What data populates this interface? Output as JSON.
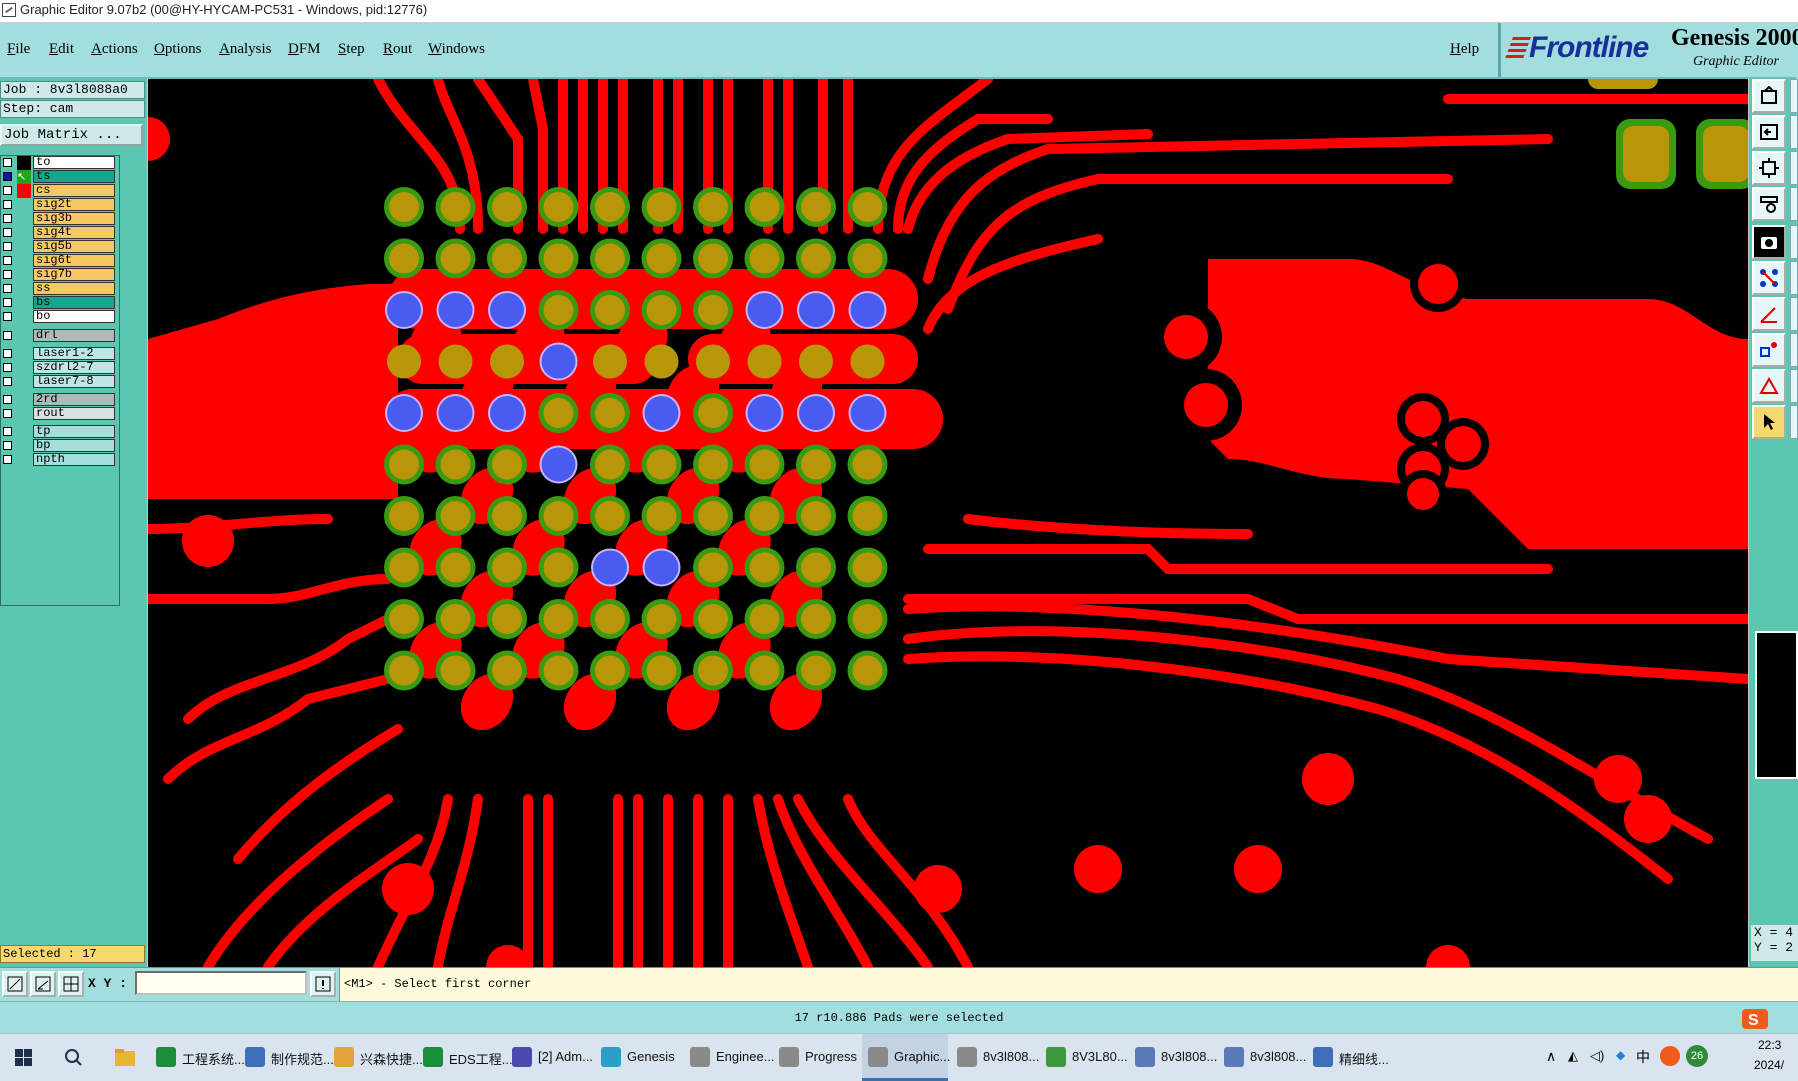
{
  "window": {
    "title": "Graphic Editor 9.07b2 (00@HY-HYCAM-PC531 - Windows, pid:12776)"
  },
  "menu": {
    "items": [
      "File",
      "Edit",
      "Actions",
      "Options",
      "Analysis",
      "DFM",
      "Step",
      "Rout",
      "Windows"
    ],
    "help": "Help"
  },
  "brand": {
    "logo": "Frontline",
    "product": "Genesis 2000",
    "subtitle": "Graphic Editor"
  },
  "job": {
    "job_label": "Job : 8v3l8088a0",
    "step_label": "Step: cam",
    "matrix_button": "Job Matrix ..."
  },
  "layers": [
    {
      "name": "to",
      "color": "#ffffff",
      "mark": "#000000"
    },
    {
      "name": "ts",
      "color": "#13a88a",
      "mark": "active"
    },
    {
      "name": "cs",
      "color": "#f6c862",
      "mark": "#ff0000"
    },
    {
      "name": "sig2t",
      "color": "#f6c862",
      "mark": ""
    },
    {
      "name": "sig3b",
      "color": "#f6c862",
      "mark": ""
    },
    {
      "name": "sig4t",
      "color": "#f6c862",
      "mark": ""
    },
    {
      "name": "sig5b",
      "color": "#f6c862",
      "mark": ""
    },
    {
      "name": "sig6t",
      "color": "#f6c862",
      "mark": ""
    },
    {
      "name": "sig7b",
      "color": "#f6c862",
      "mark": ""
    },
    {
      "name": "ss",
      "color": "#f6c862",
      "mark": ""
    },
    {
      "name": "bs",
      "color": "#13a88a",
      "mark": ""
    },
    {
      "name": "bo",
      "color": "#ffffff",
      "mark": ""
    },
    {
      "name": "drl",
      "color": "#a9bcbc",
      "mark": ""
    },
    {
      "name": "laser1-2",
      "color": "#bfe6e6",
      "mark": ""
    },
    {
      "name": "szdrl2-7",
      "color": "#bfe6e6",
      "mark": ""
    },
    {
      "name": "laser7-8",
      "color": "#bfe6e6",
      "mark": ""
    },
    {
      "name": "2rd",
      "color": "#a9bcbc",
      "mark": ""
    },
    {
      "name": "rout",
      "color": "#d8e0e0",
      "mark": ""
    },
    {
      "name": "tp",
      "color": "#a6dddd",
      "mark": ""
    },
    {
      "name": "bp",
      "color": "#a6dddd",
      "mark": ""
    },
    {
      "name": "npth",
      "color": "#a6dddd",
      "mark": ""
    }
  ],
  "selected": "Selected : 17",
  "coords": {
    "x": "X = 4",
    "y": "Y = 2"
  },
  "bottom": {
    "xy_label": "X Y :",
    "xy_value": "",
    "prompt": "<M1> - Select first corner"
  },
  "status": "17 r10.886 Pads were selected",
  "colors": {
    "copper": "#ff0000",
    "pad": "#b8960a",
    "mask": "#3a9a10",
    "selected": "#4a5cf0",
    "bg": "#000000",
    "panel": "#5cc7b0",
    "menubar": "#a3dede"
  },
  "taskbar": {
    "items": [
      {
        "label": "工程系统...",
        "icon": "#1a8f3a"
      },
      {
        "label": "制作规范...",
        "icon": "#3c6fb8"
      },
      {
        "label": "兴森快捷...",
        "icon": "#e3a43a"
      },
      {
        "label": "EDS工程...",
        "icon": "#1a8f3a"
      },
      {
        "label": "[2] Adm...",
        "icon": "#4a4ab0"
      },
      {
        "label": "Genesis",
        "icon": "#2aa0c8"
      },
      {
        "label": "Enginee...",
        "icon": "#8a8a8a"
      },
      {
        "label": "Progress",
        "icon": "#8a8a8a"
      },
      {
        "label": "Graphic...",
        "icon": "#8a8a8a"
      },
      {
        "label": "8v3l808...",
        "icon": "#8a8a8a"
      },
      {
        "label": "8V3L80...",
        "icon": "#3a9a3a"
      },
      {
        "label": "8v3l808...",
        "icon": "#5a7ab8"
      },
      {
        "label": "8v3l808...",
        "icon": "#5a7ab8"
      },
      {
        "label": "精细线...",
        "icon": "#3c6fb8"
      }
    ],
    "tray": {
      "ime": "中",
      "badge": "26",
      "time": "22:3",
      "date": "2024/"
    }
  }
}
